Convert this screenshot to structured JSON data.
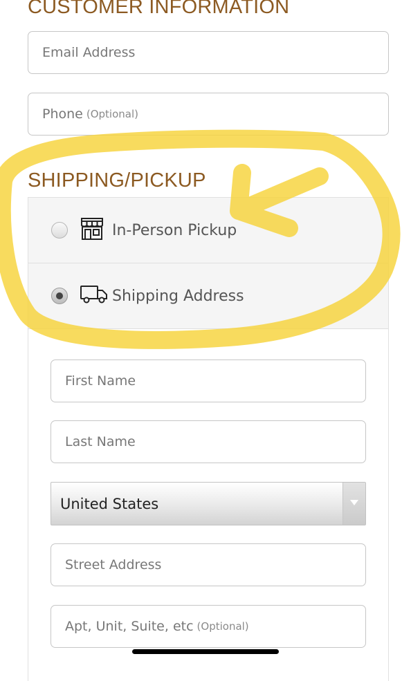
{
  "customer_information": {
    "title": "CUSTOMER INFORMATION",
    "email_placeholder": "Email Address",
    "phone_placeholder": "Phone",
    "phone_optional": "(Optional)"
  },
  "shipping": {
    "title": "SHIPPING/PICKUP",
    "options": [
      {
        "label": "In-Person Pickup",
        "icon": "storefront-icon",
        "selected": false
      },
      {
        "label": "Shipping Address",
        "icon": "delivery-truck-icon",
        "selected": true
      }
    ]
  },
  "address_form": {
    "first_name_placeholder": "First Name",
    "last_name_placeholder": "Last Name",
    "country_value": "United States",
    "street_placeholder": "Street Address",
    "apt_placeholder": "Apt, Unit, Suite, etc",
    "apt_optional": "(Optional)"
  },
  "colors": {
    "section_title": "#8c5a22",
    "highlight_marker": "#f7d33a"
  }
}
